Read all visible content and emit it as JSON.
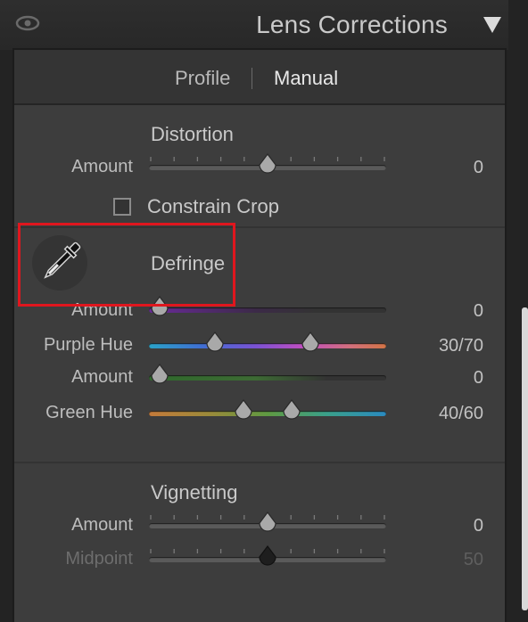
{
  "header": {
    "title": "Lens Corrections"
  },
  "tabs": [
    {
      "label": "Profile"
    },
    {
      "label": "Manual"
    }
  ],
  "distortion": {
    "title": "Distortion",
    "amount": {
      "label": "Amount",
      "value": "0"
    },
    "constrain_crop": {
      "label": "Constrain Crop",
      "checked": false
    }
  },
  "defringe": {
    "title": "Defringe",
    "purple_amount": {
      "label": "Amount",
      "value": "0"
    },
    "purple_hue": {
      "label": "Purple Hue",
      "value": "30/70"
    },
    "green_amount": {
      "label": "Amount",
      "value": "0"
    },
    "green_hue": {
      "label": "Green Hue",
      "value": "40/60"
    }
  },
  "vignetting": {
    "title": "Vignetting",
    "amount": {
      "label": "Amount",
      "value": "0"
    },
    "midpoint": {
      "label": "Midpoint",
      "value": "50"
    }
  },
  "colors": {
    "highlight": "#e0161e"
  },
  "icons": {
    "eye": "eye-icon",
    "collapse": "triangle-down-icon",
    "eyedropper": "eyedropper-icon"
  }
}
